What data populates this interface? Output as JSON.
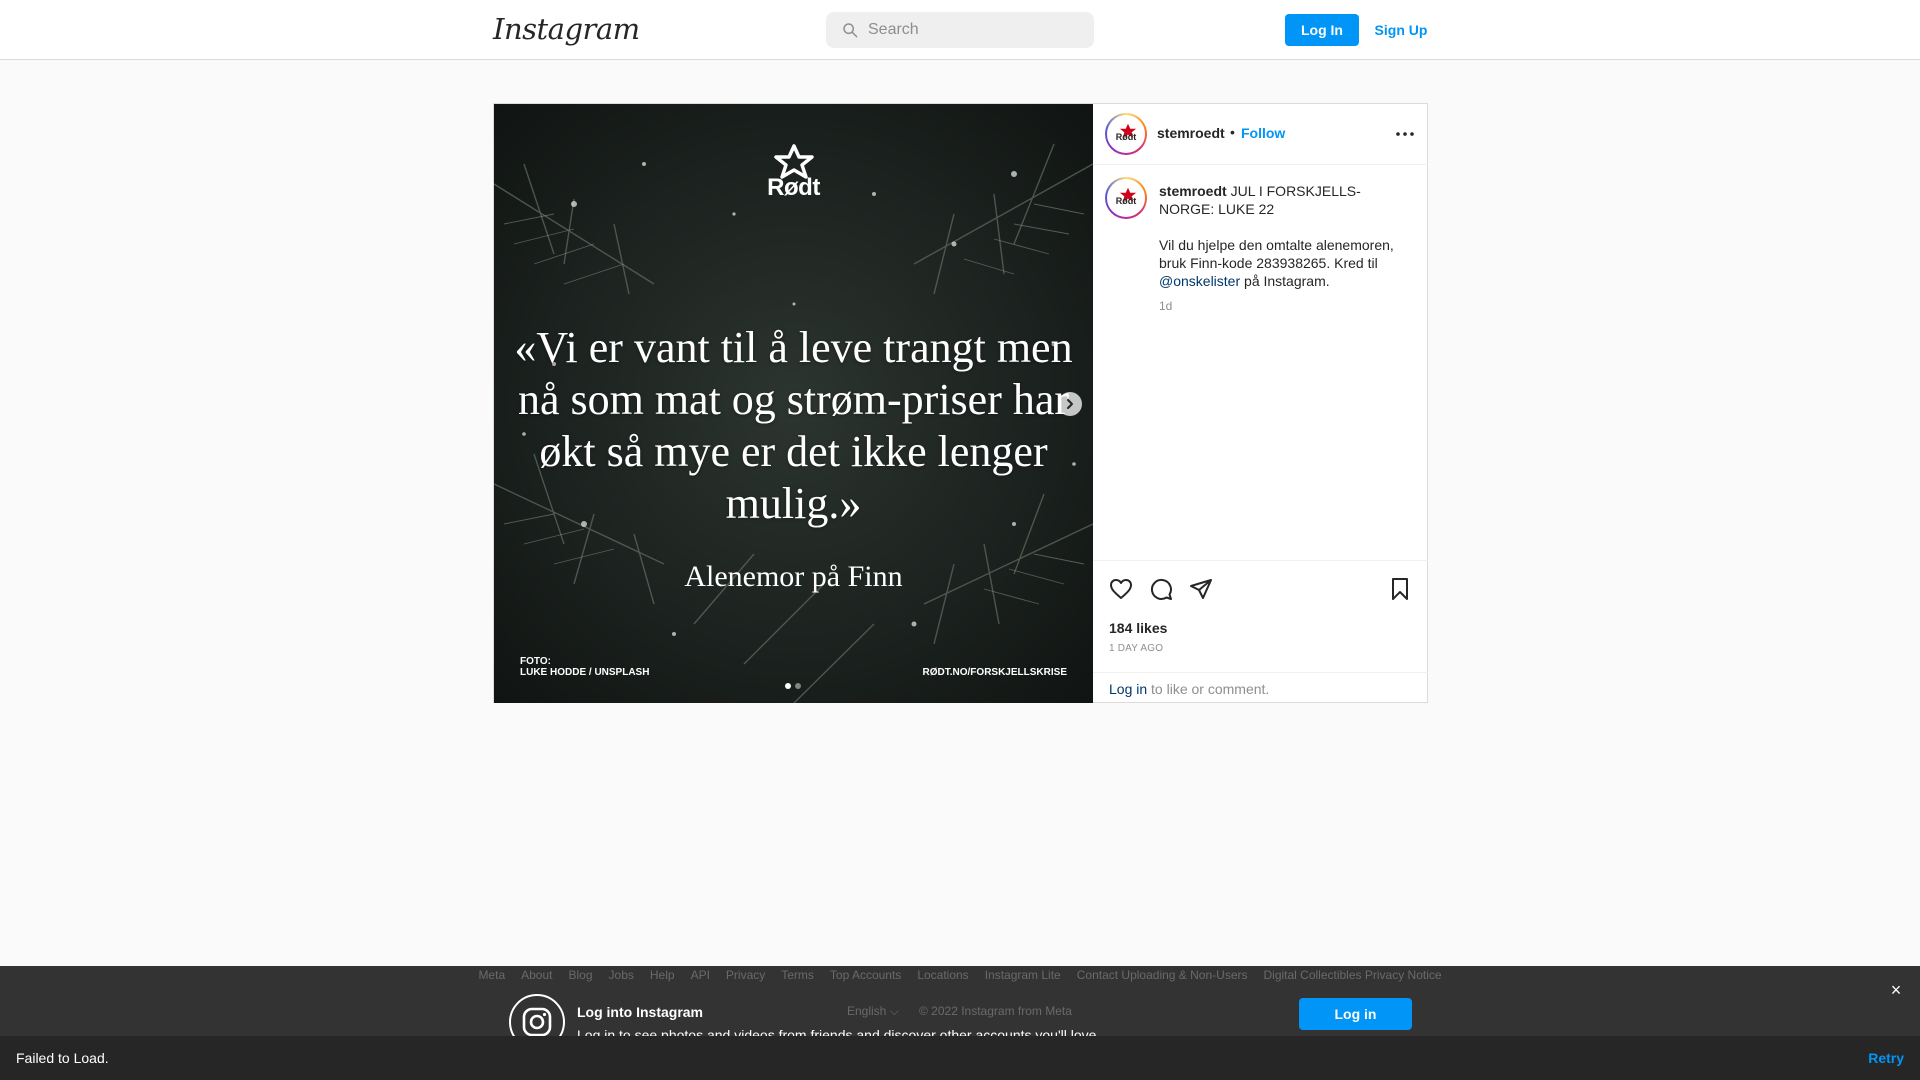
{
  "nav": {
    "logo": "Instagram",
    "search_placeholder": "Search",
    "login_label": "Log In",
    "signup_label": "Sign Up"
  },
  "post": {
    "image": {
      "brand": "Rødt",
      "quote": "«Vi er vant til å leve trangt men nå som mat og strøm-priser har økt så mye er det ikke lenger mulig.»",
      "attribution": "Alenemor på Finn",
      "credit_left": "FOTO:\nLUKE HODDE / UNSPLASH",
      "credit_right": "RØDT.NO/FORSKJELLSKRISE",
      "slide_count": 2,
      "active_slide": 1
    },
    "header": {
      "username": "stemroedt",
      "separator": "•",
      "follow_label": "Follow",
      "avatar_text": "Rødt"
    },
    "caption": {
      "username": "stemroedt",
      "line1": "JUL I FORSKJELLS-NORGE: LUKE 22",
      "para2_before": "Vil du hjelpe den omtalte alenemoren, bruk Finn-kode 283938265. Kred til ",
      "mention": "@onskelister",
      "para2_after": " på Instagram.",
      "time": "1d"
    },
    "likes": "184 likes",
    "date": "1 DAY AGO",
    "login_link": "Log in",
    "login_rest": " to like or comment."
  },
  "footer": {
    "links": [
      "Meta",
      "About",
      "Blog",
      "Jobs",
      "Help",
      "API",
      "Privacy",
      "Terms",
      "Top Accounts",
      "Locations",
      "Instagram Lite",
      "Contact Uploading & Non-Users",
      "Digital Collectibles Privacy Notice"
    ],
    "language": "English ⌵",
    "copyright": "© 2022 Instagram from Meta"
  },
  "banner": {
    "title": "Log into Instagram",
    "subtitle": "Log in to see photos and videos from friends and discover other accounts you'll love.",
    "login_label": "Log in",
    "close": "×"
  },
  "toast": {
    "message": "Failed to Load.",
    "retry": "Retry"
  },
  "colors": {
    "accent": "#0095f6",
    "mention": "#00376b",
    "muted": "#8e8e8e",
    "banner_bg": "#262626"
  },
  "icons": [
    "search-icon",
    "heart-icon",
    "comment-icon",
    "share-icon",
    "bookmark-icon",
    "more-icon",
    "chevron-right-icon",
    "instagram-icon",
    "close-icon",
    "star-icon"
  ]
}
